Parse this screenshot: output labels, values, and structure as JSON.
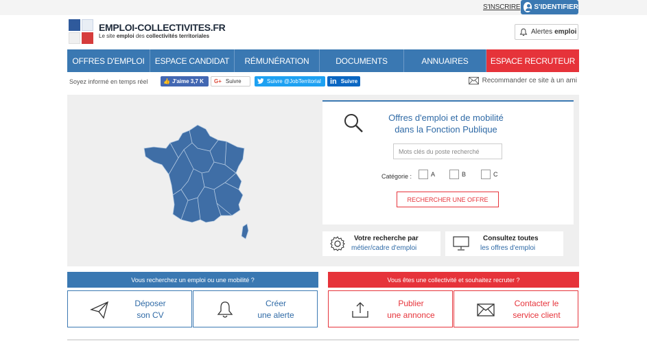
{
  "topbar": {
    "inscrire_label": "S'INSCRIRE",
    "identifier_label": "S'IDENTIFIER"
  },
  "header": {
    "site_title": "EMPLOI-COLLECTIVITES.FR",
    "subtitle_prefix": "Le site",
    "subtitle_emploi": "emploi",
    "subtitle_mid": "des",
    "subtitle_bold": "collectivités territoriales",
    "alertes_label": "Alertes",
    "alertes_bold": "emploi"
  },
  "nav": {
    "items": [
      {
        "label": "OFFRES D'EMPLOI"
      },
      {
        "label": "ESPACE CANDIDAT"
      },
      {
        "label": "RÉMUNÉRATION"
      },
      {
        "label": "DOCUMENTS"
      },
      {
        "label": "ANNUAIRES"
      },
      {
        "label": "ESPACE RECRUTEUR"
      }
    ]
  },
  "social": {
    "text": "Soyez informé en temps réel",
    "fb_label": "J'aime 3,7 K",
    "gplus_letter": "G+",
    "gplus_label": "Suivre",
    "tw_label": "Suivre @JobTerritorial",
    "li_letter": "in",
    "li_label": "Suivre",
    "recommander_label": "Recommander ce site à un ami"
  },
  "search": {
    "title_line1": "Offres d'emploi et de mobilité",
    "title_line2": "dans la Fonction Publique",
    "keyword_placeholder": "Mots clés du poste recherché",
    "category_label": "Catégorie :",
    "categories": [
      "A",
      "B",
      "C"
    ],
    "button_label": "RECHERCHER UNE OFFRE"
  },
  "cards": {
    "metier_line1": "Votre recherche par",
    "metier_line2": "métier/cadre d'emploi",
    "toutes_line1": "Consultez toutes",
    "toutes_line2": "les offres d'emploi"
  },
  "bottom": {
    "candidate_band": "Vous recherchez un emploi ou une mobilité ?",
    "recruiter_band": "Vous êtes une collectivité et souhaitez recruter ?",
    "cv_line1": "Déposer",
    "cv_line2": "son CV",
    "alerte_line1": "Créer",
    "alerte_line2": "une alerte",
    "annonce_line1": "Publier",
    "annonce_line2": "une annonce",
    "contact_line1": "Contacter le",
    "contact_line2": "service client"
  },
  "colors": {
    "primary_blue": "#3a78b2",
    "accent_red": "#e6333a",
    "map_blue": "#3f6ea6"
  }
}
